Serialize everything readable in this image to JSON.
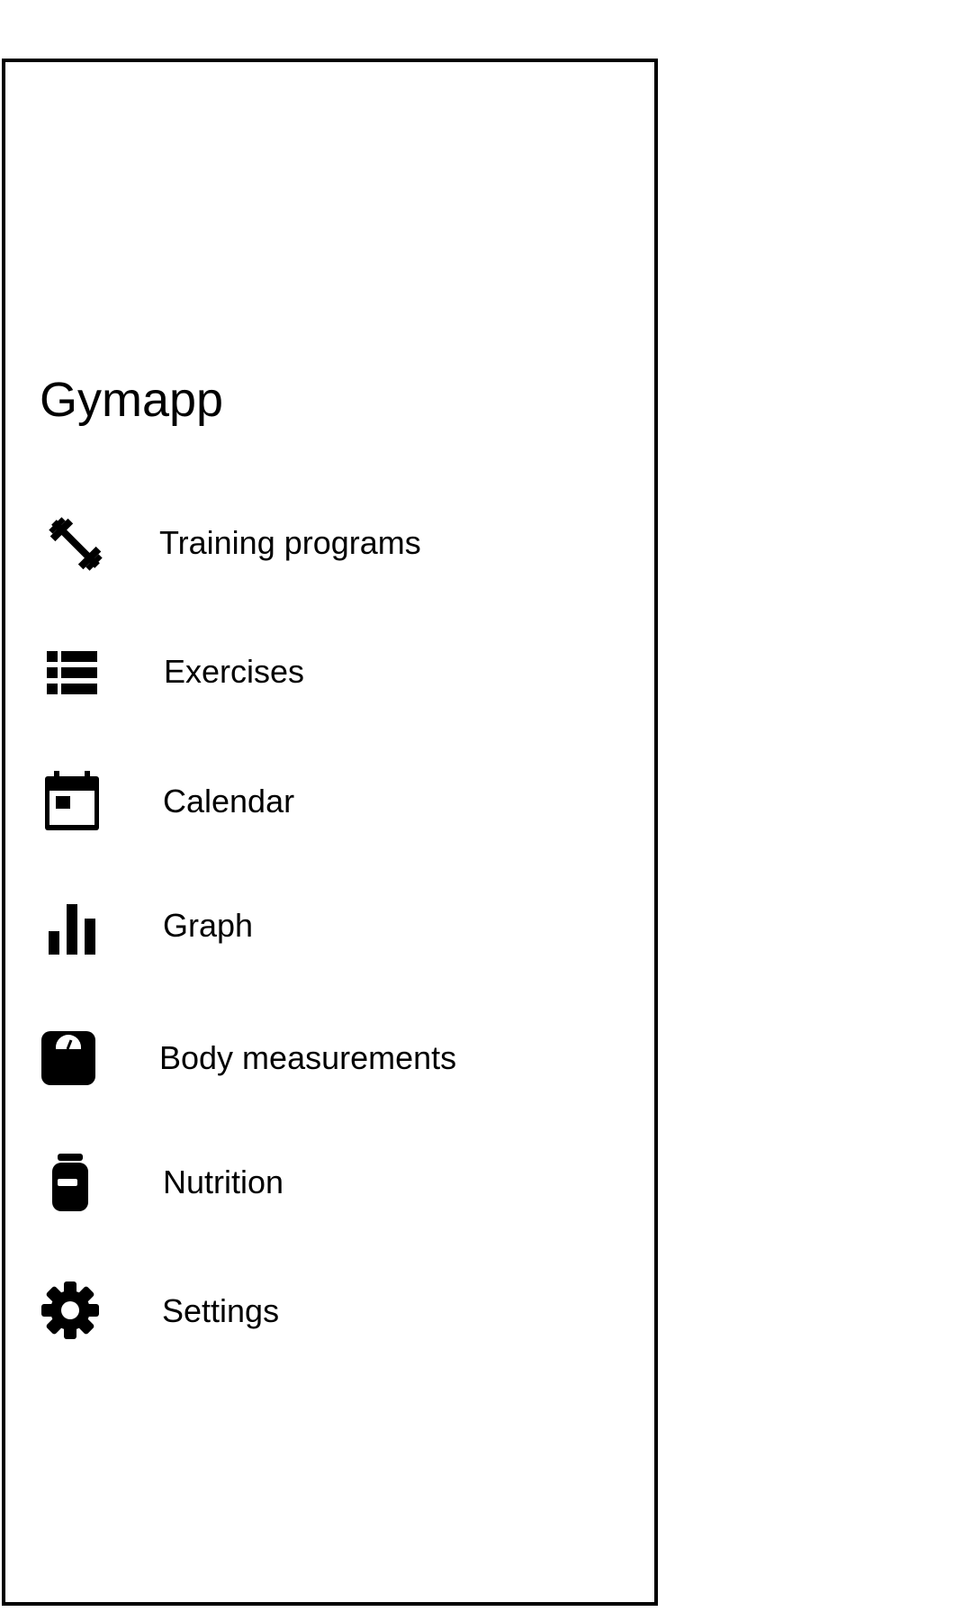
{
  "app": {
    "title": "Gymapp"
  },
  "nav": {
    "items": [
      {
        "label": "Training programs",
        "icon": "dumbbell-icon"
      },
      {
        "label": "Exercises",
        "icon": "list-icon"
      },
      {
        "label": "Calendar",
        "icon": "calendar-icon"
      },
      {
        "label": "Graph",
        "icon": "bar-chart-icon"
      },
      {
        "label": "Body measurements",
        "icon": "scale-icon"
      },
      {
        "label": "Nutrition",
        "icon": "supplement-jar-icon"
      },
      {
        "label": "Settings",
        "icon": "gear-icon"
      }
    ]
  },
  "colors": {
    "foreground": "#000000",
    "background": "#ffffff"
  }
}
